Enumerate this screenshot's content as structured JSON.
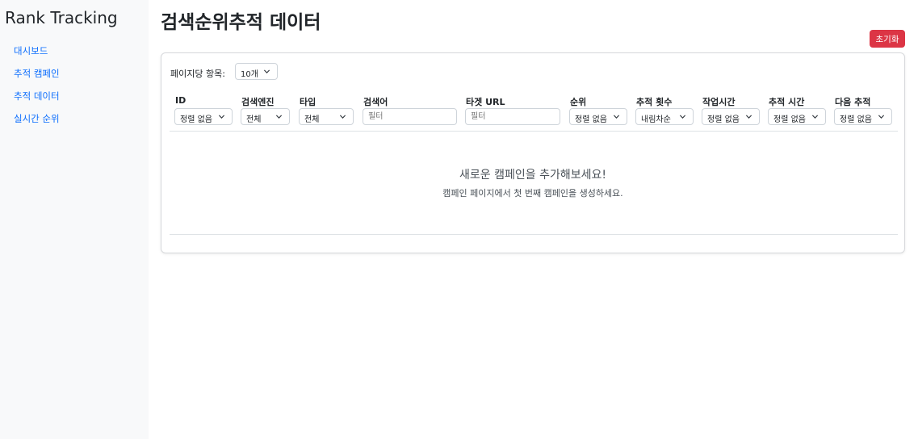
{
  "sidebar": {
    "brand": "Rank Tracking",
    "items": [
      {
        "label": "대시보드"
      },
      {
        "label": "추적 캠페인"
      },
      {
        "label": "추적 데이터"
      },
      {
        "label": "실시간 순위"
      }
    ]
  },
  "main": {
    "title": "검색순위추적 데이터",
    "reset_label": "초기화",
    "per_page_label": "페이지당 항목:",
    "per_page_value": "10개",
    "columns": [
      {
        "header": "ID",
        "filter": "정렬 없음"
      },
      {
        "header": "검색엔진",
        "filter": "전체"
      },
      {
        "header": "타입",
        "filter": "전체"
      },
      {
        "header": "검색어",
        "placeholder": "필터"
      },
      {
        "header": "타겟 URL",
        "placeholder": "필터"
      },
      {
        "header": "순위",
        "filter": "정렬 없음"
      },
      {
        "header": "추적 횟수",
        "filter": "내림차순"
      },
      {
        "header": "작업시간",
        "filter": "정렬 없음"
      },
      {
        "header": "추적 시간",
        "filter": "정렬 없음"
      },
      {
        "header": "다음 추적",
        "filter": "정렬 없음"
      }
    ],
    "empty_title": "새로운 캠페인을 추가해보세요!",
    "empty_subtitle": "캠페인 페이지에서 첫 번째 캠페인을 생성하세요."
  },
  "colors": {
    "accent": "#0d6efd",
    "danger": "#dc3545",
    "sidebar_bg": "#f8f9fa"
  }
}
